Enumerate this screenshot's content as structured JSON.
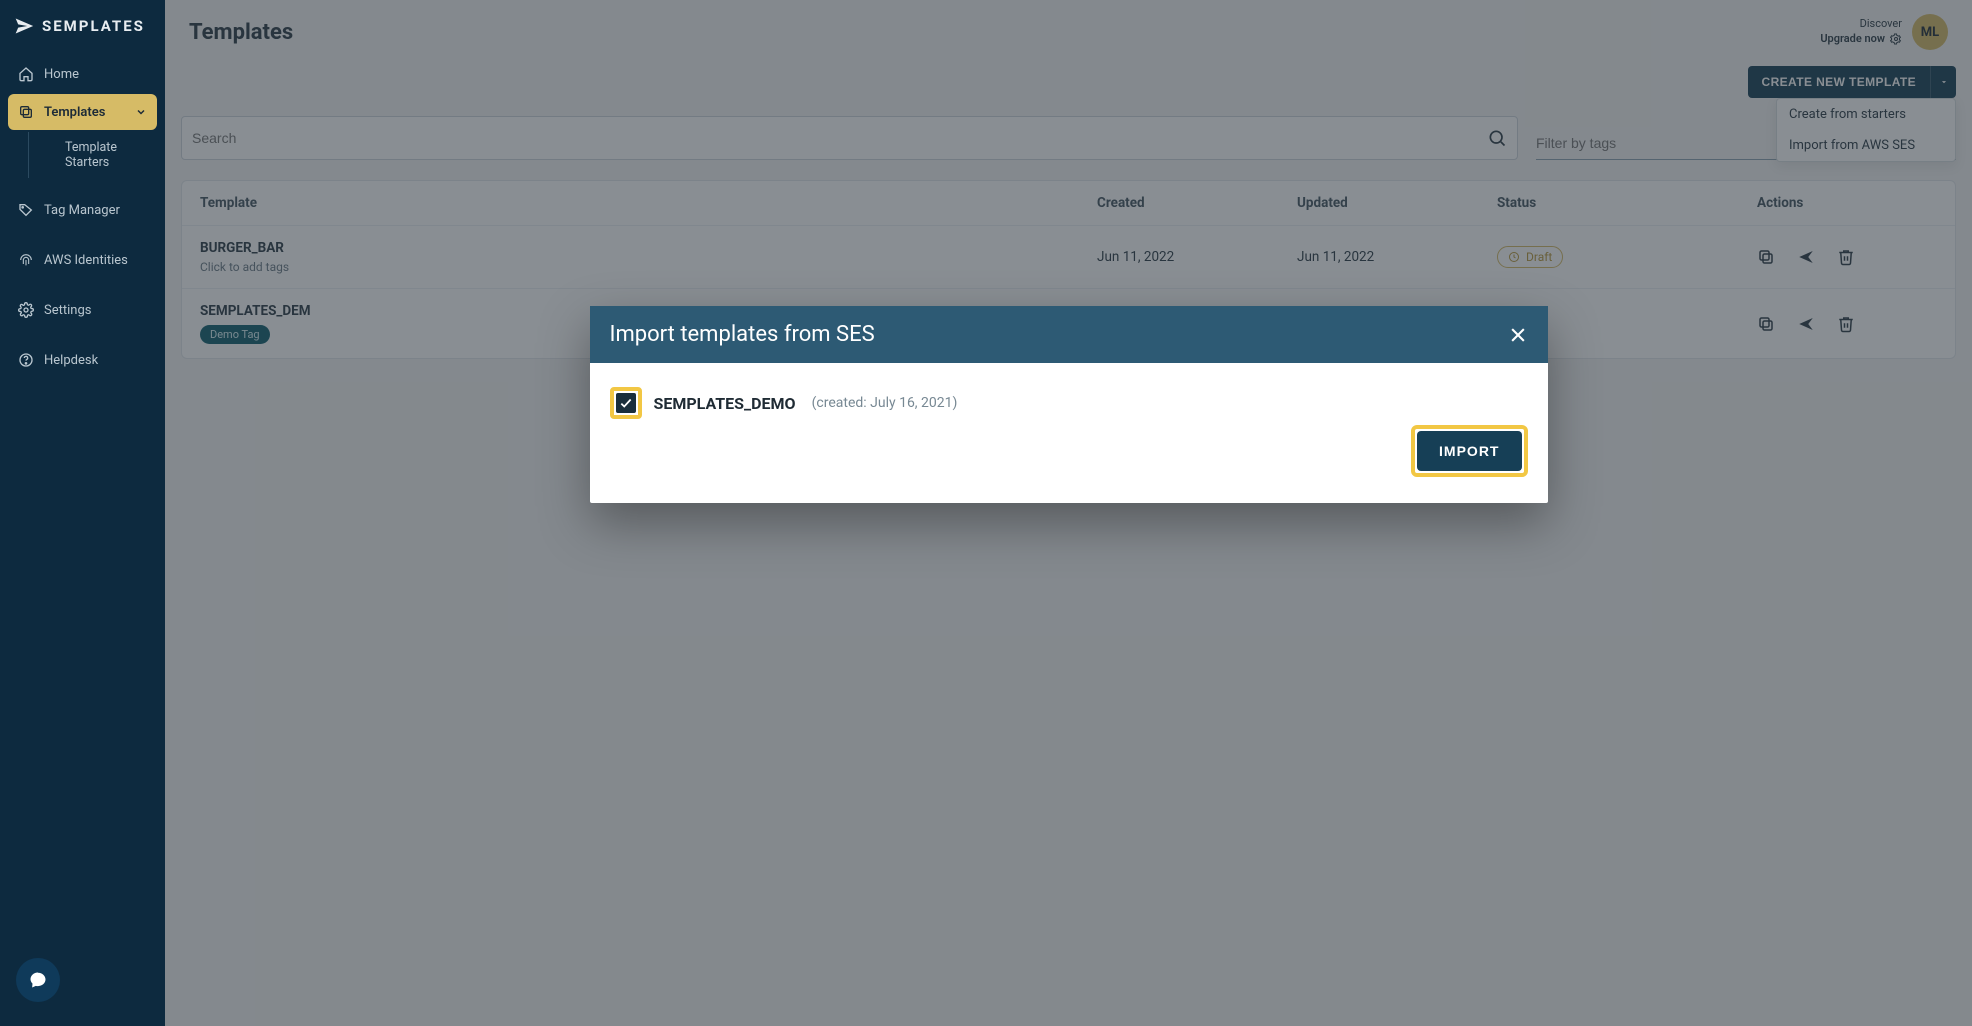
{
  "brand": "SEMPLATES",
  "sidebar": {
    "items": [
      {
        "label": "Home"
      },
      {
        "label": "Templates"
      },
      {
        "label": "Tag Manager"
      },
      {
        "label": "AWS Identities"
      },
      {
        "label": "Settings"
      },
      {
        "label": "Helpdesk"
      }
    ],
    "sub_templates": "Template Starters"
  },
  "header": {
    "title": "Templates",
    "discover": "Discover",
    "upgrade": "Upgrade now",
    "avatar_initials": "ML"
  },
  "toolbar": {
    "create_label": "CREATE NEW TEMPLATE",
    "menu": {
      "from_starters": "Create from starters",
      "from_ses": "Import from AWS SES"
    }
  },
  "filters": {
    "search_placeholder": "Search",
    "tag_placeholder": "Filter by tags"
  },
  "table": {
    "columns": {
      "template": "Template",
      "created": "Created",
      "updated": "Updated",
      "status": "Status",
      "actions": "Actions"
    },
    "rows": [
      {
        "name": "BURGER_BAR",
        "tagline": "Click to add tags",
        "created": "Jun 11, 2022",
        "updated": "Jun 11, 2022",
        "status": "Draft"
      },
      {
        "name": "SEMPLATES_DEM",
        "chip": "Demo Tag"
      }
    ]
  },
  "modal": {
    "title": "Import templates from SES",
    "item_name": "SEMPLATES_DEMO",
    "item_meta": "(created:  July 16, 2021)",
    "import_label": "IMPORT"
  }
}
